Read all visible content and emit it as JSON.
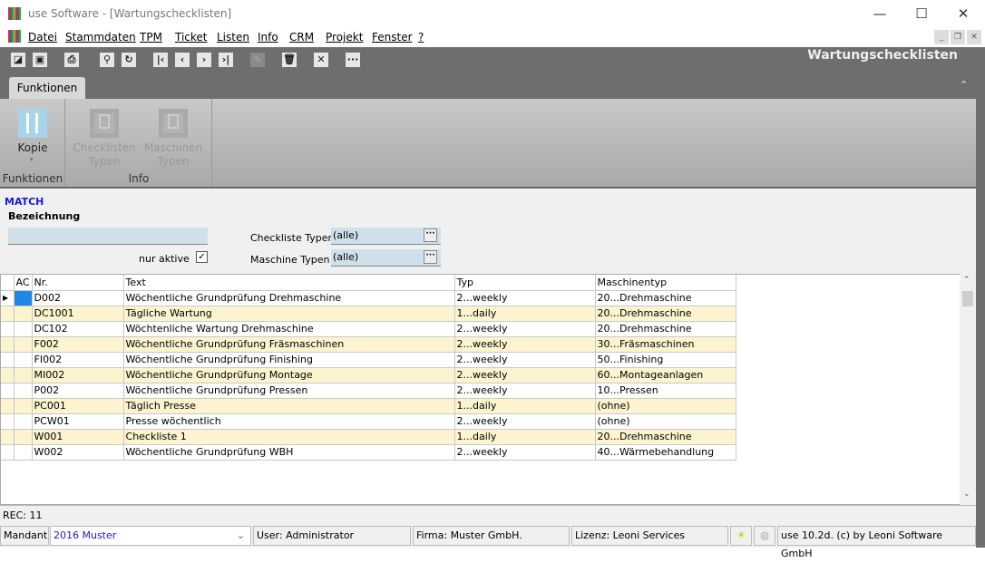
{
  "window": {
    "title": "use Software - [Wartungschecklisten]",
    "minimize": "—",
    "maximize": "☐",
    "close": "✕"
  },
  "menu": [
    "Datei",
    "Stammdaten",
    "TPM",
    "Ticket",
    "Listen",
    "Info",
    "CRM",
    "Projekt",
    "Fenster",
    "?"
  ],
  "toolbar": {
    "app_title": "Wartungschecklisten",
    "icons": [
      "new-icon",
      "save-icon",
      "print-icon",
      "search-icon",
      "refresh-icon",
      "first-record-icon",
      "previous-record-icon",
      "next-record-icon",
      "last-record-icon",
      "edit-icon",
      "delete-icon",
      "cancel-icon",
      "more-icon"
    ]
  },
  "ribbon": {
    "tab": "Funktionen",
    "groups": [
      {
        "label": "Funktionen",
        "buttons": [
          {
            "label": "Kopie"
          }
        ]
      },
      {
        "label": "Info",
        "buttons": [
          {
            "label1": "Checklisten",
            "label2": "Typen"
          },
          {
            "label1": "Maschinen",
            "label2": "Typen"
          }
        ]
      }
    ]
  },
  "filter": {
    "mode": "MATCH",
    "bezeichnung_label": "Bezeichnung",
    "bezeichnung_value": "",
    "nur_aktive_label": "nur aktive",
    "nur_aktive_checked": true,
    "checkliste_typen_label": "Checkliste Typen",
    "checkliste_typen_value": "(alle)",
    "maschine_typen_label": "Maschine Typen",
    "maschine_typen_value": "(alle)",
    "dots": "···"
  },
  "grid": {
    "columns": [
      "AC",
      "Nr.",
      "Text",
      "Typ",
      "Maschinentyp"
    ],
    "rows": [
      [
        "",
        "D002",
        "Wöchentliche Grundprüfung Drehmaschine",
        "2...weekly",
        "20...Drehmaschine"
      ],
      [
        "",
        "DC1001",
        "Tägliche Wartung",
        "1...daily",
        "20...Drehmaschine"
      ],
      [
        "",
        "DC102",
        "Wöchtenliche Wartung Drehmaschine",
        "2...weekly",
        "20...Drehmaschine"
      ],
      [
        "",
        "F002",
        "Wöchentliche Grundprüfung Fräsmaschinen",
        "2...weekly",
        "30...Fräsmaschinen"
      ],
      [
        "",
        "FI002",
        "Wöchentliche Grundprüfung Finishing",
        "2...weekly",
        "50...Finishing"
      ],
      [
        "",
        "MI002",
        "Wöchentliche Grundprüfung Montage",
        "2...weekly",
        "60...Montageanlagen"
      ],
      [
        "",
        "P002",
        "Wöchentliche Grundprüfung Pressen",
        "2...weekly",
        "10...Pressen"
      ],
      [
        "",
        "PC001",
        "Täglich Presse",
        "1...daily",
        "(ohne)"
      ],
      [
        "",
        "PCW01",
        "Presse wöchentlich",
        "2...weekly",
        "(ohne)"
      ],
      [
        "",
        "W001",
        "Checkliste 1",
        "1...daily",
        "20...Drehmaschine"
      ],
      [
        "",
        "W002",
        "Wöchentliche Grundprüfung WBH",
        "2...weekly",
        "40...Wärmebehandlung"
      ]
    ]
  },
  "rec": "REC: 11",
  "status": {
    "mandant_label": "Mandant",
    "mandant_value": "2016 Muster",
    "user": "User: Administrator",
    "firma": "Firma: Muster GmbH.",
    "lizenz": "Lizenz: Leoni Services",
    "version": "use 10.2d. (c) by Leoni Software GmbH"
  },
  "colors": {
    "toolbar": "#6e6e6e",
    "alt_row": "#fcf3cf",
    "selected_cell": "#1e88e5",
    "match": "#1a1ad0",
    "input_bg": "#cfe0ea"
  }
}
